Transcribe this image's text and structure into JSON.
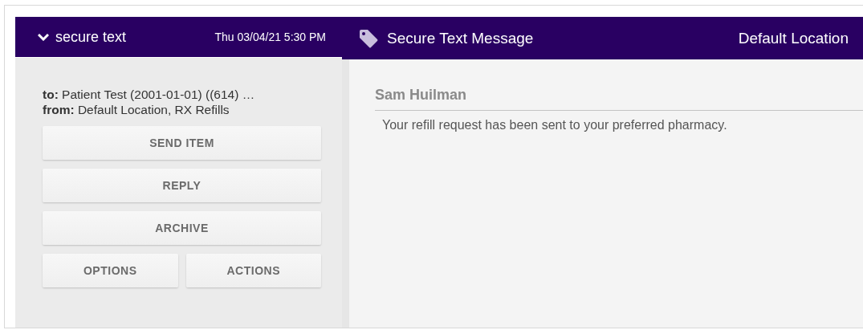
{
  "item_header": {
    "expanded": true,
    "title": "secure text",
    "timestamp": "Thu 03/04/21 5:30 PM"
  },
  "details": [
    "**to:** Patient Test (2001-01-01) ((614) …",
    "**from:** Default Location, RX Refills"
  ],
  "buttons": [
    {
      "label": "SEND ITEM",
      "wide": true
    },
    {
      "label": "REPLY",
      "wide": true
    },
    {
      "label": "ARCHIVE",
      "wide": true
    },
    {
      "label": "OPTIONS",
      "wide": false
    },
    {
      "label": "ACTIONS",
      "wide": false
    }
  ],
  "message_header": {
    "title": "Secure Text Message",
    "location": "Default Location"
  },
  "message": {
    "sender": "Sam Huilman",
    "body": "Your refill request has been sent to your preferred pharmacy."
  }
}
